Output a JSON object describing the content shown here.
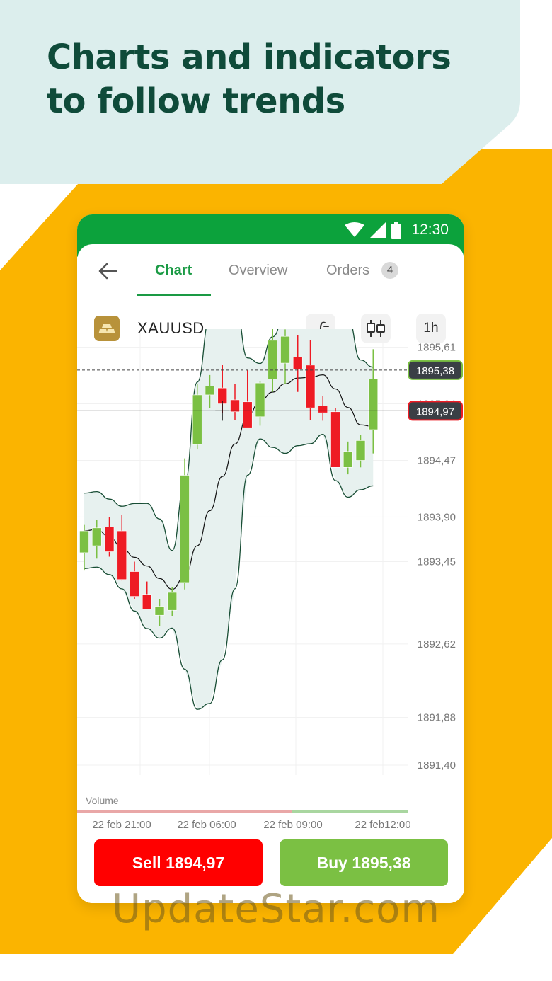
{
  "headline": {
    "line1": "Charts and indicators",
    "line2": "to follow trends"
  },
  "colors": {
    "yellow": "#fbb400",
    "mint": "#dceeed",
    "green_header": "#0ca23c",
    "accent_green": "#1a9a44",
    "up_candle": "#7bc043",
    "down_candle": "#ee1b24",
    "sell": "#ff0000",
    "buy": "#7bc043"
  },
  "status_bar": {
    "time": "12:30",
    "icons": [
      "wifi-icon",
      "signal-icon",
      "battery-icon"
    ]
  },
  "tabs": [
    {
      "label": "Chart",
      "active": true
    },
    {
      "label": "Overview",
      "active": false
    },
    {
      "label": "Orders",
      "active": false,
      "badge": "4"
    }
  ],
  "instrument": {
    "symbol": "XAUUSD",
    "icon": "gold-bar-icon",
    "timeframe": "1h",
    "tools": [
      "indicator-icon",
      "candle-type-icon"
    ]
  },
  "price_axis": [
    "1895,61",
    "1895,04",
    "1894,47",
    "1893,90",
    "1893,45",
    "1892,62",
    "1891,88",
    "1891,40"
  ],
  "time_axis": [
    "22 feb 21:00",
    "22 feb 06:00",
    "22 feb 09:00",
    "22 feb12:00"
  ],
  "volume_label": "Volume",
  "ask_label": "1895,38",
  "bid_label": "1894,97",
  "chart_data": {
    "type": "candlestick",
    "indicator": "bollinger-bands",
    "candles": [
      {
        "o": 1893.54,
        "h": 1893.82,
        "l": 1893.36,
        "c": 1893.76
      },
      {
        "o": 1893.61,
        "h": 1893.87,
        "l": 1893.48,
        "c": 1893.79
      },
      {
        "o": 1893.8,
        "h": 1893.9,
        "l": 1893.5,
        "c": 1893.55
      },
      {
        "o": 1893.76,
        "h": 1893.92,
        "l": 1893.26,
        "c": 1893.27
      },
      {
        "o": 1893.35,
        "h": 1893.45,
        "l": 1893.07,
        "c": 1893.1
      },
      {
        "o": 1893.12,
        "h": 1893.25,
        "l": 1892.97,
        "c": 1892.97
      },
      {
        "o": 1892.91,
        "h": 1893.07,
        "l": 1892.8,
        "c": 1893.0
      },
      {
        "o": 1892.96,
        "h": 1893.19,
        "l": 1892.9,
        "c": 1893.14
      },
      {
        "o": 1893.24,
        "h": 1894.49,
        "l": 1893.17,
        "c": 1894.32
      },
      {
        "o": 1894.63,
        "h": 1895.24,
        "l": 1894.58,
        "c": 1895.13
      },
      {
        "o": 1895.13,
        "h": 1895.33,
        "l": 1895.0,
        "c": 1895.22
      },
      {
        "o": 1895.2,
        "h": 1895.43,
        "l": 1894.95,
        "c": 1895.04
      },
      {
        "o": 1895.08,
        "h": 1895.24,
        "l": 1894.88,
        "c": 1894.96
      },
      {
        "o": 1895.06,
        "h": 1895.38,
        "l": 1894.82,
        "c": 1894.8
      },
      {
        "o": 1894.91,
        "h": 1895.27,
        "l": 1894.82,
        "c": 1895.25
      },
      {
        "o": 1895.29,
        "h": 1895.84,
        "l": 1895.16,
        "c": 1895.68
      },
      {
        "o": 1895.45,
        "h": 1895.79,
        "l": 1895.24,
        "c": 1895.72
      },
      {
        "o": 1895.51,
        "h": 1895.73,
        "l": 1895.16,
        "c": 1895.39
      },
      {
        "o": 1895.43,
        "h": 1895.68,
        "l": 1894.88,
        "c": 1895.0
      },
      {
        "o": 1895.02,
        "h": 1895.12,
        "l": 1894.87,
        "c": 1894.95
      },
      {
        "o": 1894.96,
        "h": 1895.0,
        "l": 1894.4,
        "c": 1894.4
      },
      {
        "o": 1894.4,
        "h": 1894.66,
        "l": 1894.33,
        "c": 1894.56
      },
      {
        "o": 1894.47,
        "h": 1894.73,
        "l": 1894.4,
        "c": 1894.67
      },
      {
        "o": 1894.78,
        "h": 1895.59,
        "l": 1894.54,
        "c": 1895.29
      }
    ],
    "ask": 1895.38,
    "bid": 1894.97,
    "y_range": [
      1891.3,
      1895.75
    ]
  },
  "actions": {
    "sell": "Sell 1894,97",
    "buy": "Buy 1895,38"
  },
  "watermark": "UpdateStar.com"
}
